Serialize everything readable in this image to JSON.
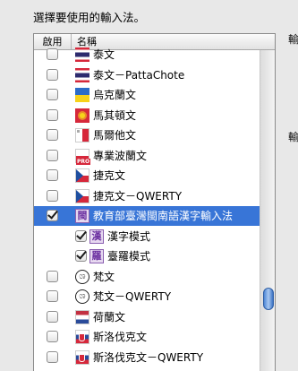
{
  "heading": "選擇要使用的輸入法。",
  "clipped_right_labels": [
    "輸",
    "輸"
  ],
  "table": {
    "col_enable": "啟用",
    "col_name": "名稱"
  },
  "rows": [
    {
      "label": "泰文",
      "checked": false,
      "flag": "th",
      "indent": false
    },
    {
      "label": "泰文－PattaChote",
      "checked": false,
      "flag": "th",
      "indent": false
    },
    {
      "label": "烏克蘭文",
      "checked": false,
      "flag": "ua",
      "indent": false
    },
    {
      "label": "馬其頓文",
      "checked": false,
      "flag": "mk",
      "indent": false
    },
    {
      "label": "馬爾他文",
      "checked": false,
      "flag": "mt",
      "indent": false
    },
    {
      "label": "專業波蘭文",
      "checked": false,
      "flag": "pl-pro",
      "indent": false
    },
    {
      "label": "捷克文",
      "checked": false,
      "flag": "cz",
      "indent": false
    },
    {
      "label": "捷克文－QWERTY",
      "checked": false,
      "flag": "cz",
      "indent": false
    },
    {
      "label": "教育部臺灣閩南語漢字輸入法",
      "checked": true,
      "flag": "tw-ime",
      "indent": false,
      "selected": true
    },
    {
      "label": "漢字模式",
      "checked": true,
      "flag": "tw-han",
      "indent": true
    },
    {
      "label": "臺羅模式",
      "checked": true,
      "flag": "tw-lo",
      "indent": true
    },
    {
      "label": "梵文",
      "checked": false,
      "flag": "khmer",
      "indent": false
    },
    {
      "label": "梵文－QWERTY",
      "checked": false,
      "flag": "khmer",
      "indent": false
    },
    {
      "label": "荷蘭文",
      "checked": false,
      "flag": "nl",
      "indent": false
    },
    {
      "label": "斯洛伐克文",
      "checked": false,
      "flag": "sk",
      "indent": false
    },
    {
      "label": "斯洛伐克文－QWERTY",
      "checked": false,
      "flag": "sk",
      "indent": false
    }
  ],
  "icons": {
    "tw-ime": "閩",
    "tw-han": "漢",
    "tw-lo": "羅",
    "khmer": "ශ"
  },
  "colors": {
    "selection": "#3875d7",
    "scroll_thumb": "#4d86d6"
  }
}
